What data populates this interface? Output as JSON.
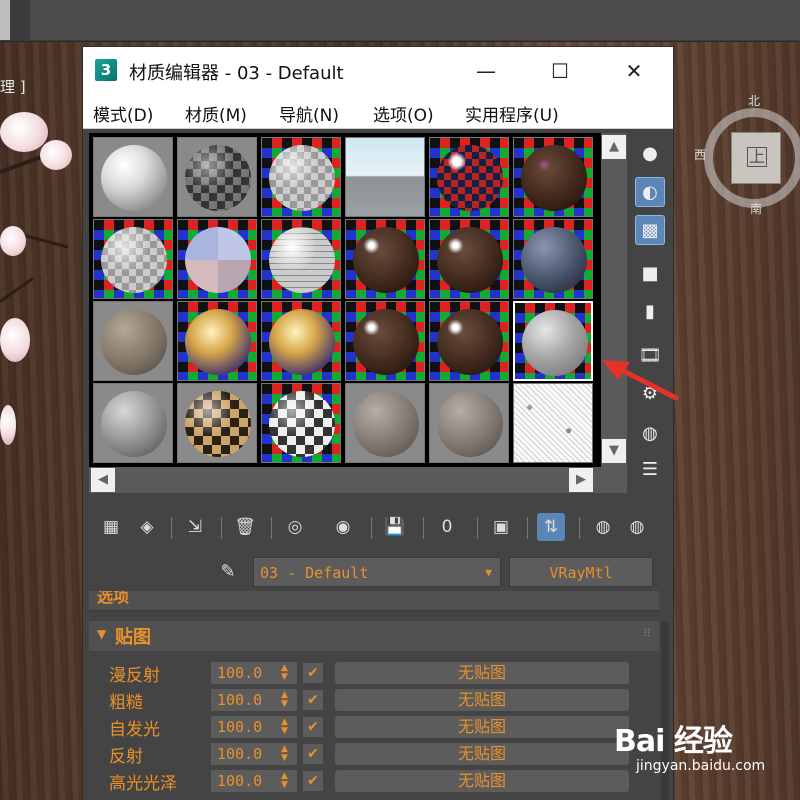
{
  "background": {
    "viewport_label": "理 ]",
    "viewcube": {
      "north": "北",
      "west": "西",
      "south": "南",
      "face": "上"
    }
  },
  "window": {
    "icon_text": "3",
    "title": "材质编辑器 - 03 - Default",
    "controls": {
      "minimize": "—",
      "maximize": "☐",
      "close": "✕"
    }
  },
  "menu": [
    "模式(D)",
    "材质(M)",
    "导航(N)",
    "选项(O)",
    "实用程序(U)"
  ],
  "scroll": {
    "up": "▲",
    "down": "▼",
    "left": "◀",
    "right": "▶"
  },
  "sample_slots": [
    [
      {
        "bg": "grey",
        "sphere": "white-matte"
      },
      {
        "bg": "grey",
        "sphere": "dark-checker"
      },
      {
        "bg": "checker",
        "sphere": "grey-checker"
      },
      {
        "bg": "sky",
        "sphere": "none"
      },
      {
        "bg": "checker",
        "sphere": "checker-gloss"
      },
      {
        "bg": "checker",
        "sphere": "wood-dark"
      }
    ],
    [
      {
        "bg": "checker",
        "sphere": "grey-checker"
      },
      {
        "bg": "checker",
        "sphere": "multi-sub"
      },
      {
        "bg": "checker",
        "sphere": "tile"
      },
      {
        "bg": "checker",
        "sphere": "wood-gloss"
      },
      {
        "bg": "checker",
        "sphere": "wood-gloss"
      },
      {
        "bg": "checker",
        "sphere": "fabric-dark"
      }
    ],
    [
      {
        "bg": "grey",
        "sphere": "stone"
      },
      {
        "bg": "checker",
        "sphere": "gold-blur"
      },
      {
        "bg": "checker",
        "sphere": "gold-blur"
      },
      {
        "bg": "checker",
        "sphere": "wood-gloss"
      },
      {
        "bg": "checker",
        "sphere": "wood-gloss"
      },
      {
        "bg": "checker",
        "sphere": "grey-selected",
        "selected": true
      }
    ],
    [
      {
        "bg": "grey",
        "sphere": "grey-smooth"
      },
      {
        "bg": "grey",
        "sphere": "gold-checker"
      },
      {
        "bg": "checker",
        "sphere": "bw-checker"
      },
      {
        "bg": "grey",
        "sphere": "grey-rough"
      },
      {
        "bg": "grey",
        "sphere": "grey-rough"
      },
      {
        "bg": "white",
        "sphere": "speckle"
      }
    ]
  ],
  "side_tools": [
    {
      "icon": "sample-type-sphere-icon",
      "glyph": "●",
      "active": false
    },
    {
      "icon": "backlight-icon",
      "glyph": "◐",
      "active": true
    },
    {
      "icon": "background-checker-icon",
      "glyph": "▩",
      "active": true
    },
    {
      "icon": "sample-uv-tiling-icon",
      "glyph": "■",
      "active": false
    },
    {
      "icon": "video-color-check-icon",
      "glyph": "▮",
      "active": false
    },
    {
      "icon": "make-preview-icon",
      "glyph": "🎞",
      "active": false
    },
    {
      "icon": "options-icon",
      "glyph": "⚙",
      "active": false
    },
    {
      "icon": "select-by-material-icon",
      "glyph": "◍",
      "active": false
    },
    {
      "icon": "material-map-navigator-icon",
      "glyph": "☰",
      "active": false
    }
  ],
  "toolbar": [
    {
      "icon": "get-material-icon",
      "glyph": "▦"
    },
    {
      "icon": "put-to-scene-icon",
      "glyph": "◈"
    },
    {
      "icon": "assign-to-selection-icon",
      "glyph": "⇲"
    },
    {
      "icon": "delete-icon",
      "glyph": "🗑"
    },
    {
      "icon": "copy-material-icon",
      "glyph": "◎"
    },
    {
      "icon": "make-unique-icon",
      "glyph": "◉"
    },
    {
      "icon": "save-to-library-icon",
      "glyph": "💾"
    },
    {
      "icon": "material-id-icon",
      "glyph": "0"
    },
    {
      "icon": "show-shaded-map-icon",
      "glyph": "▣"
    },
    {
      "icon": "show-end-result-icon",
      "glyph": "⇅"
    },
    {
      "icon": "go-to-parent-icon",
      "glyph": "◍"
    },
    {
      "icon": "go-forward-sibling-icon",
      "glyph": "◍"
    }
  ],
  "material": {
    "name": "03 - Default",
    "type": "VRayMtl"
  },
  "rollouts": {
    "previous_title": "选项",
    "maps_title": "贴图",
    "maps": [
      {
        "label": "漫反射",
        "value": "100.0",
        "checked": "✔",
        "button": "无贴图"
      },
      {
        "label": "粗糙",
        "value": "100.0",
        "checked": "✔",
        "button": "无贴图"
      },
      {
        "label": "自发光",
        "value": "100.0",
        "checked": "✔",
        "button": "无贴图"
      },
      {
        "label": "反射",
        "value": "100.0",
        "checked": "✔",
        "button": "无贴图"
      },
      {
        "label": "高光光泽",
        "value": "100.0",
        "checked": "✔",
        "button": "无贴图"
      }
    ]
  },
  "watermark": {
    "main": "Bai 经验",
    "sub": "jingyan.baidu.com"
  },
  "colors": {
    "accent_orange": "#e8912a",
    "panel_bg": "#444444",
    "active_blue": "#5a86b8",
    "annotation_red": "#e8302a"
  }
}
